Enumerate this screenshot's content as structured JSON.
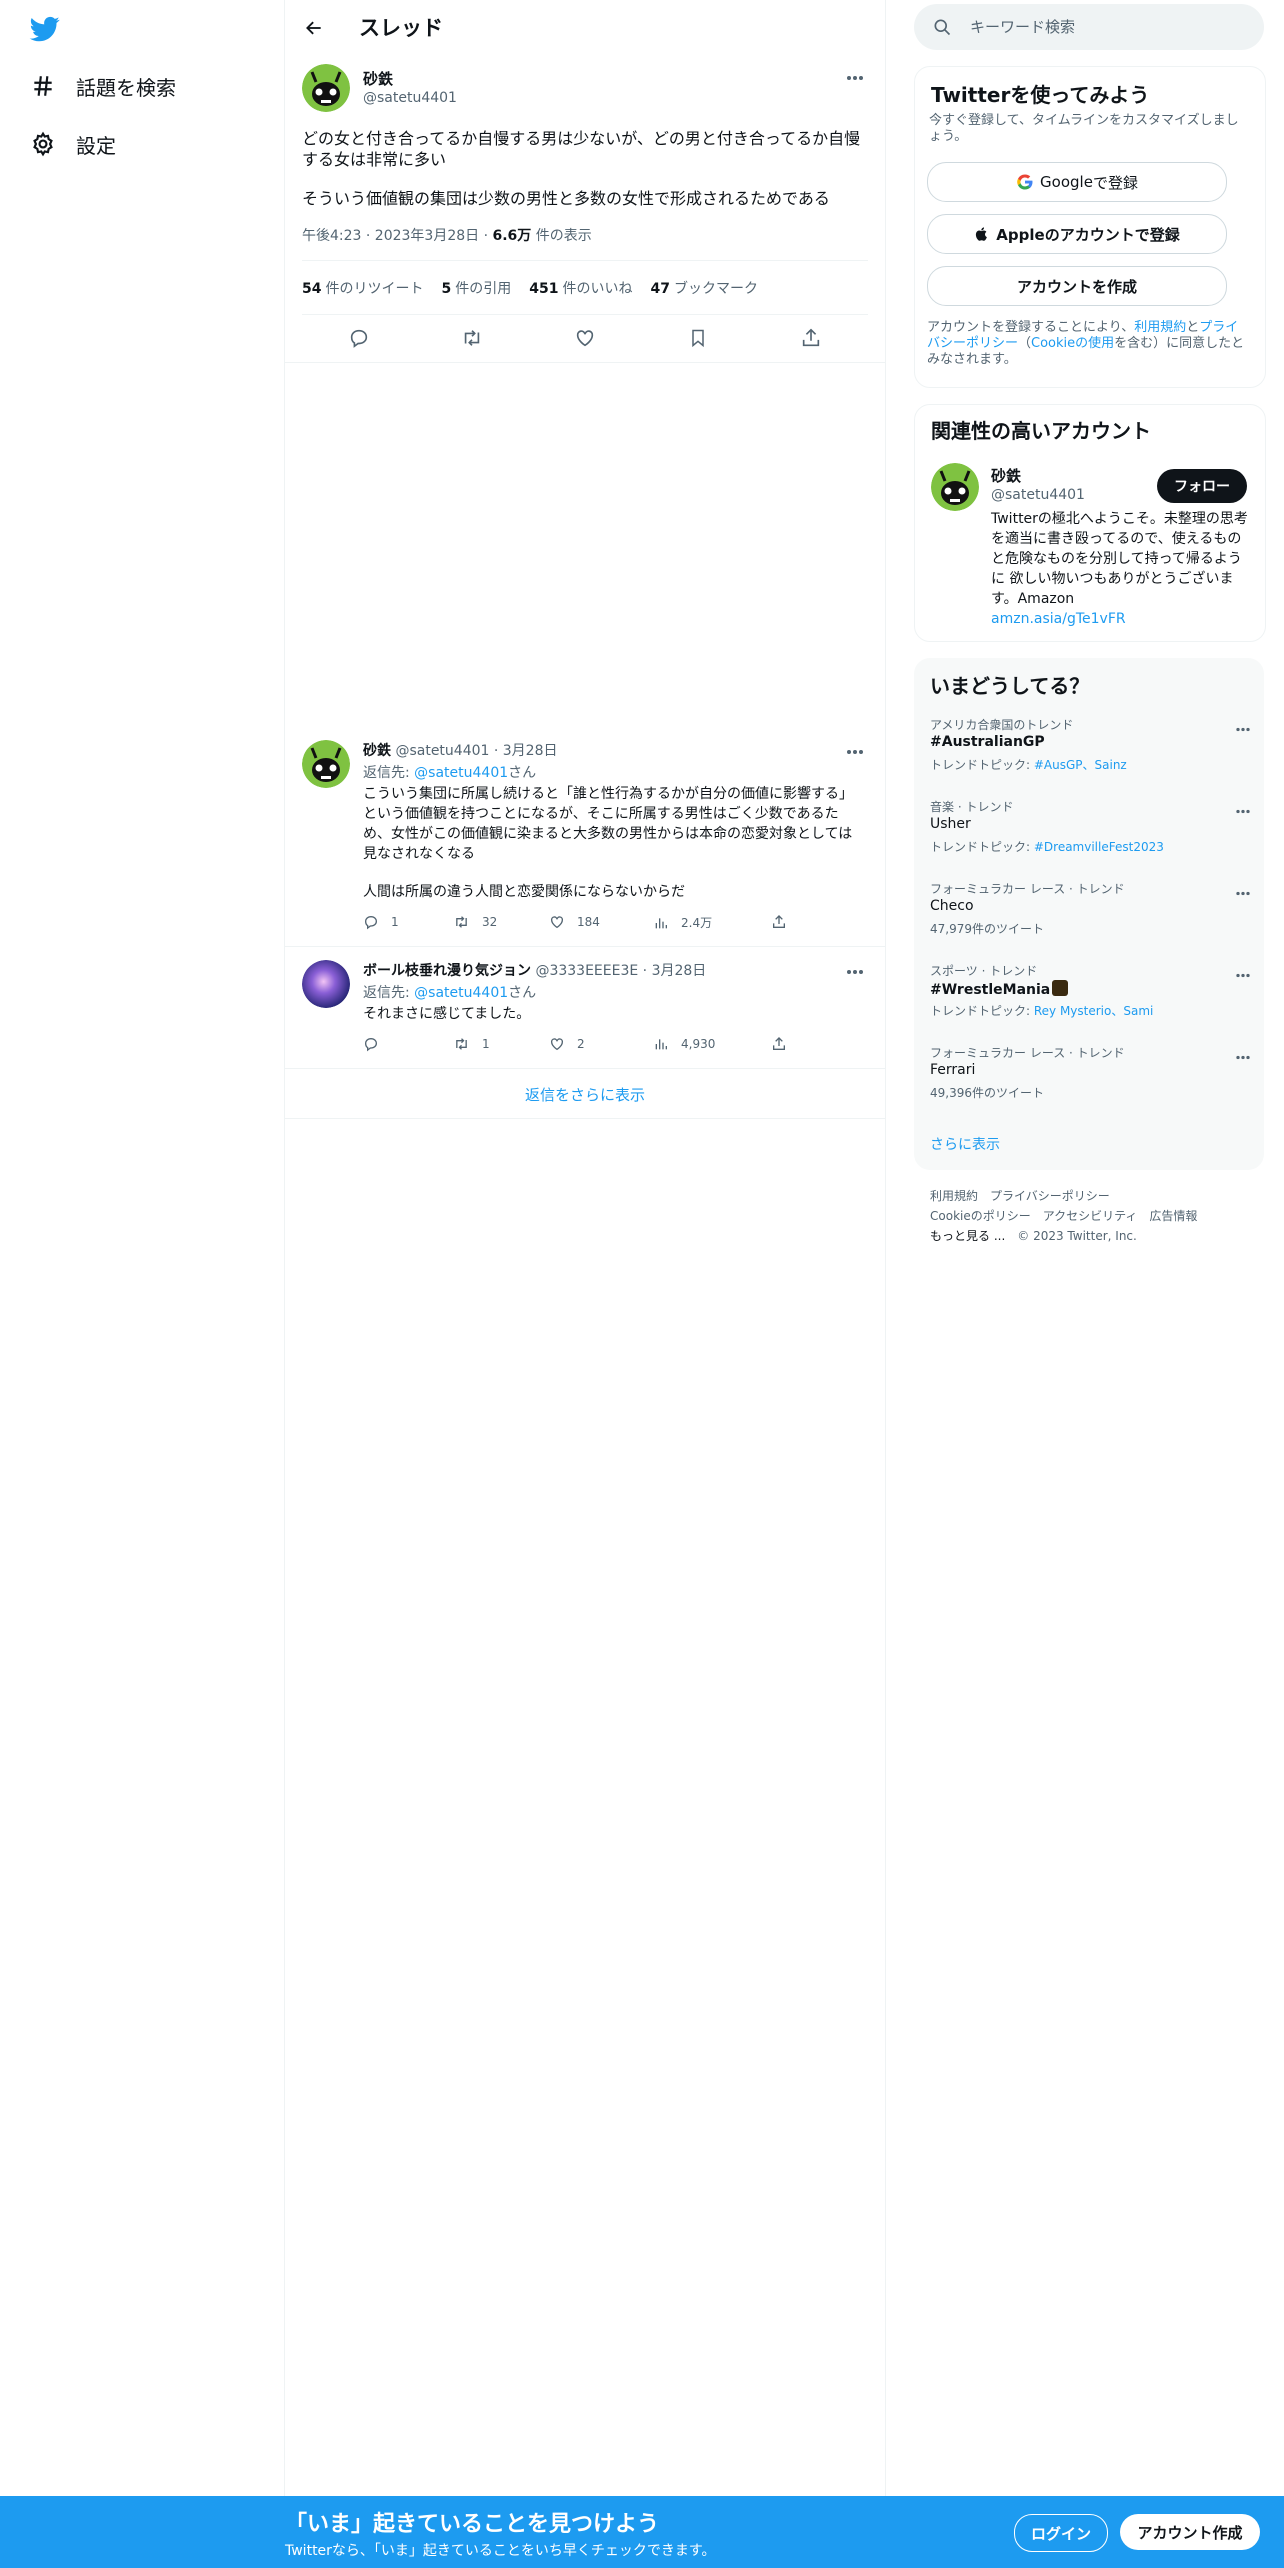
{
  "colors": {
    "accent": "#1d9bf0",
    "text": "#0f1419",
    "muted": "#536471",
    "border": "#eff3f4"
  },
  "nav": {
    "logo_icon": "twitter-bird-icon",
    "items": [
      {
        "icon": "hashtag-icon",
        "label": "話題を検索"
      },
      {
        "icon": "gear-icon",
        "label": "設定"
      }
    ]
  },
  "thread": {
    "title": "スレッド",
    "main_tweet": {
      "name": "砂鉄",
      "handle": "@satetu4401",
      "text1": "どの女と付き合ってるか自慢する男は少ないが、どの男と付き合ってるか自慢する女は非常に多い",
      "text2": "そういう価値観の集団は少数の男性と多数の女性で形成されるためである",
      "time": "午後4:23 · 2023年3月28日 · ",
      "views_count": "6.6万",
      "views_label": " 件の表示",
      "stats": [
        {
          "count": "54",
          "label": "件のリツイート"
        },
        {
          "count": "5",
          "label": "件の引用"
        },
        {
          "count": "451",
          "label": "件のいいね"
        },
        {
          "count": "47",
          "label": "ブックマーク"
        }
      ]
    },
    "replies": [
      {
        "name": "砂鉄",
        "handle_date": " @satetu4401 · 3月28日",
        "reply_prefix": "返信先: ",
        "reply_to": "@satetu4401",
        "reply_suffix": "さん",
        "text1": "こういう集団に所属し続けると「誰と性行為するかが自分の価値に影響する」という価値観を持つことになるが、そこに所属する男性はごく少数であるため、女性がこの価値観に染まると大多数の男性からは本命の恋愛対象としては見なされなくなる",
        "text2": "人間は所属の違う人間と恋愛関係にならないからだ",
        "replies": "1",
        "retweets": "32",
        "likes": "184",
        "views": "2.4万"
      },
      {
        "name": "ボール枝垂れ漫り気ジョン",
        "handle_date": " @3333EEEE3E · 3月28日",
        "reply_prefix": "返信先: ",
        "reply_to": "@satetu4401",
        "reply_suffix": "さん",
        "text1": "それまさに感じてました。",
        "replies": "",
        "retweets": "1",
        "likes": "2",
        "views": "4,930"
      }
    ],
    "show_more": "返信をさらに表示"
  },
  "search": {
    "placeholder": "キーワード検索"
  },
  "signup_card": {
    "title": "Twitterを使ってみよう",
    "subtitle": "今すぐ登録して、タイムラインをカスタマイズしましょう。",
    "google_label": " で登録",
    "google_word": "Google",
    "apple_label": "Appleのアカウントで登録",
    "create_label": "アカウントを作成",
    "terms_prefix": "アカウントを登録することにより、",
    "terms_link": "利用規約",
    "terms_and": "と",
    "privacy_link": "プライバシーポリシー",
    "cookie_open": "（",
    "cookie_link": "Cookieの使用",
    "terms_suffix": "を含む）に同意したとみなされます。"
  },
  "related": {
    "title": "関連性の高いアカウント",
    "name": "砂鉄",
    "handle": "@satetu4401",
    "follow_label": "フォロー",
    "bio": "Twitterの極北へようこそ。未整理の思考を適当に書き殴ってるので、使えるものと危険なものを分別して持って帰るように 欲しい物いつもありがとうございます。Amazon",
    "bio_link": "amzn.asia/gTe1vFR"
  },
  "trends": {
    "title": "いまどうしてる？",
    "items": [
      {
        "context": "アメリカ合衆国のトレンド",
        "name": "#AustralianGP",
        "sub_prefix": "トレンドトピック: ",
        "sub_links": "#AusGP、Sainz",
        "bold": true
      },
      {
        "context": "音楽 · トレンド",
        "name": "Usher",
        "sub_prefix": "トレンドトピック: ",
        "sub_links": "#DreamvilleFest2023",
        "bold": false
      },
      {
        "context": "フォーミュラカー レース · トレンド",
        "name": "Checo",
        "sub_prefix": "47,979件のツイート",
        "sub_links": "",
        "bold": false
      },
      {
        "context": "スポーツ · トレンド",
        "name": "#WrestleMania",
        "sub_prefix": "トレンドトピック: ",
        "sub_links": "Rey Mysterio、Sami",
        "bold": true
      },
      {
        "context": "フォーミュラカー レース · トレンド",
        "name": "Ferrari",
        "sub_prefix": "49,396件のツイート",
        "sub_links": "",
        "bold": false
      }
    ],
    "show_more": "さらに表示"
  },
  "footer": {
    "terms": "利用規約",
    "privacy": "プライバシーポリシー",
    "cookie": "Cookieのポリシー",
    "accessibility": "アクセシビリティ",
    "ads": "広告情報",
    "more": "もっと見る ...",
    "copyright": "© 2023 Twitter, Inc."
  },
  "bottom_bar": {
    "title": "「いま」起きていることを見つけよう",
    "subtitle": "Twitterなら、「いま」起きていることをいち早くチェックできます。",
    "login_label": "ログイン",
    "signup_label": "アカウント作成"
  }
}
